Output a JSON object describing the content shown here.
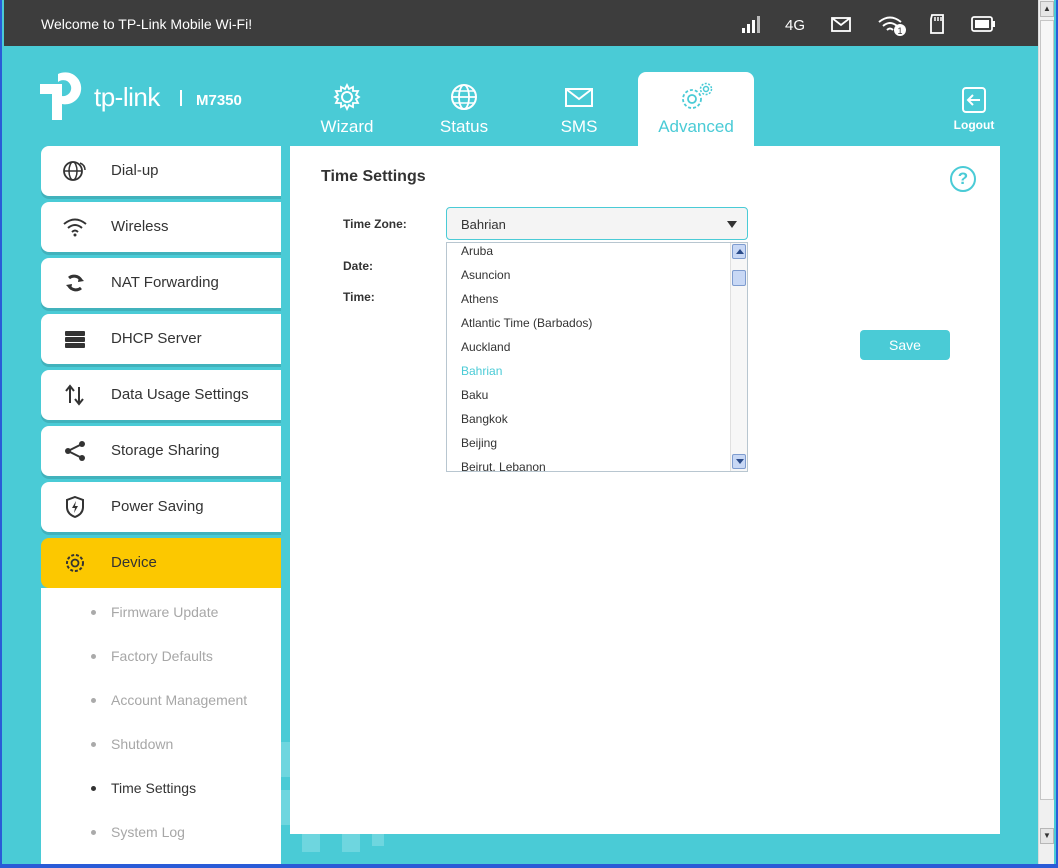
{
  "topbar": {
    "welcome": "Welcome to TP-Link Mobile Wi-Fi!",
    "network": "4G",
    "wifi_clients": "1"
  },
  "header": {
    "brand": "tp-link",
    "model": "M7350",
    "tabs": [
      {
        "label": "Wizard",
        "icon": "gear-icon"
      },
      {
        "label": "Status",
        "icon": "globe-icon"
      },
      {
        "label": "SMS",
        "icon": "envelope-icon"
      },
      {
        "label": "Advanced",
        "icon": "gears-icon",
        "active": true
      }
    ],
    "logout": "Logout"
  },
  "sidebar": {
    "items": [
      {
        "label": "Dial-up",
        "icon": "globe-dialup-icon"
      },
      {
        "label": "Wireless",
        "icon": "wifi-icon"
      },
      {
        "label": "NAT Forwarding",
        "icon": "nat-icon"
      },
      {
        "label": "DHCP Server",
        "icon": "server-icon"
      },
      {
        "label": "Data Usage Settings",
        "icon": "data-arrows-icon"
      },
      {
        "label": "Storage Sharing",
        "icon": "share-icon"
      },
      {
        "label": "Power Saving",
        "icon": "shield-icon"
      },
      {
        "label": "Device",
        "icon": "gear-icon",
        "active": true
      }
    ],
    "subitems": [
      {
        "label": "Firmware Update"
      },
      {
        "label": "Factory Defaults"
      },
      {
        "label": "Account Management"
      },
      {
        "label": "Shutdown"
      },
      {
        "label": "Time Settings",
        "current": true
      },
      {
        "label": "System Log"
      }
    ]
  },
  "main": {
    "title": "Time Settings",
    "help": "?",
    "time_zone_label": "Time Zone:",
    "time_zone_value": "Bahrian",
    "date_label": "Date:",
    "time_label": "Time:",
    "save_label": "Save",
    "dropdown_options": [
      "Aruba",
      "Asuncion",
      "Athens",
      "Atlantic Time (Barbados)",
      "Auckland",
      "Bahrian",
      "Baku",
      "Bangkok",
      "Beijing",
      "Beirut, Lebanon"
    ],
    "selected_option": "Bahrian"
  },
  "colors": {
    "accent": "#4acbd6",
    "active_menu": "#fcc800",
    "topbar": "#3d3d3d"
  }
}
